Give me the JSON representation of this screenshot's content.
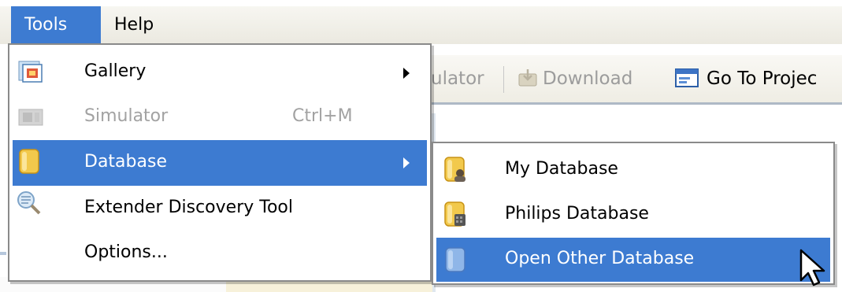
{
  "menubar": {
    "items": [
      {
        "label": "Tools"
      },
      {
        "label": "Help"
      }
    ]
  },
  "toolbar": {
    "simulator_label": "ulator",
    "download_label": "Download",
    "goto_label": "Go To Projec"
  },
  "tools_menu": {
    "items": [
      {
        "label": "Gallery",
        "icon": "gallery-icon",
        "submenu": true
      },
      {
        "label": "Simulator",
        "icon": "simulator-icon",
        "shortcut": "Ctrl+M",
        "disabled": true
      },
      {
        "label": "Database",
        "icon": "database-icon",
        "submenu": true,
        "highlighted": true
      },
      {
        "label": "Extender Discovery Tool",
        "icon": "discovery-icon"
      },
      {
        "label": "Options..."
      }
    ]
  },
  "database_submenu": {
    "items": [
      {
        "label": "My Database",
        "icon": "my-database-icon"
      },
      {
        "label": "Philips Database",
        "icon": "philips-database-icon"
      },
      {
        "label": "Open Other Database",
        "icon": "open-database-icon",
        "highlighted": true
      }
    ]
  },
  "colors": {
    "highlight": "#3d7bd1",
    "menubar": "#ebe9e0",
    "disabled_text": "#a2a2a2",
    "database_icon": "#f2c94c"
  }
}
